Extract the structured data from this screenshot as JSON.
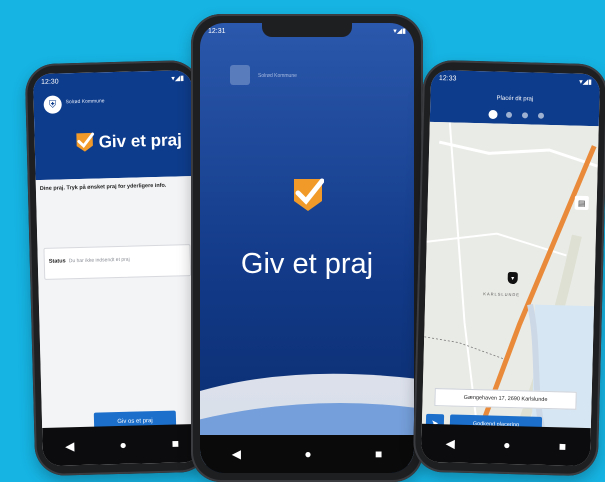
{
  "left_phone": {
    "status_time": "12:30",
    "municipality": "Solrød Kommune",
    "app_title": "Giv et praj",
    "hint": "Dine praj. Tryk på ønsket praj for yderligere info.",
    "status_label": "Status",
    "status_value": "Du har ikke indsendt et praj",
    "send_button": "Giv os et praj"
  },
  "center_phone": {
    "status_time": "12:31",
    "municipality": "Solrød Kommune",
    "app_title": "Giv et praj"
  },
  "right_phone": {
    "status_time": "12:33",
    "title": "Placér dit praj",
    "address": "Gængehaven 17, 2690 Karlslunde",
    "approve_button": "Godkend placering",
    "map_label": "KARLSLUNDE"
  },
  "nav": {
    "back": "◀",
    "home": "●",
    "recent": "■"
  },
  "colors": {
    "background": "#16b4e3",
    "brand_blue": "#0e3c8c",
    "badge_orange": "#f19a2a",
    "button_blue": "#1c6fcb"
  }
}
